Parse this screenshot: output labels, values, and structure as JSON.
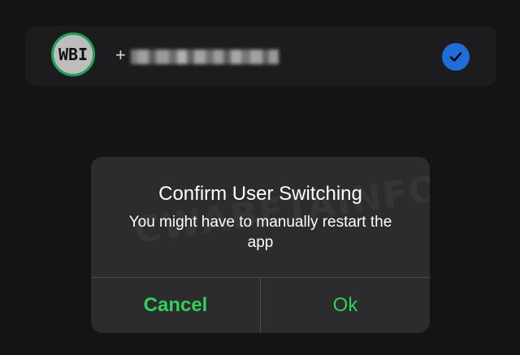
{
  "account": {
    "avatar_text": "WBI",
    "phone_prefix": "+",
    "phone_number_obscured": "",
    "selected": true,
    "avatar_ring_color": "#1fa35a",
    "check_color": "#1e6dd9"
  },
  "dialog": {
    "title": "Confirm User Switching",
    "message": "You might have to manually restart the app",
    "cancel_label": "Cancel",
    "ok_label": "Ok",
    "action_color": "#30d158",
    "watermark": "CWABETAINFO"
  }
}
